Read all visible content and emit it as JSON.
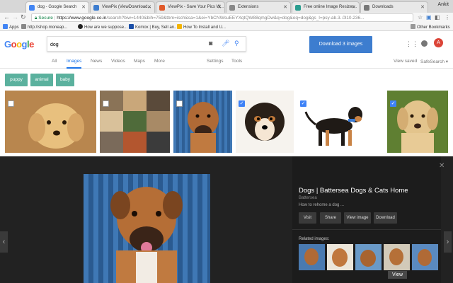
{
  "browser": {
    "tabs": [
      {
        "title": "dog - Google Search",
        "favicon_color": "#4285f4"
      },
      {
        "title": "ViewPix (ViewDownload...",
        "favicon_color": "#3d7dcf"
      },
      {
        "title": "ViewPix - Save Your Pics W...",
        "favicon_color": "#e05a2b"
      },
      {
        "title": "Extensions",
        "favicon_color": "#888888"
      },
      {
        "title": "Free online Image Resizer...",
        "favicon_color": "#2a9d8f"
      },
      {
        "title": "Downloads",
        "favicon_color": "#777777"
      }
    ],
    "profile_name": "Ankit",
    "secure_label": "Secure",
    "url_host": "https://www.google.co.in",
    "url_rest": "/search?biw=1440&bih=759&tbm=isch&sa=1&ei=YbCNWsuEEYXqtQW88qmgDw&q=dog&oq=dog&gs_l=psy-ab.3..0l10.236...",
    "bookmarks": [
      {
        "label": "Apps",
        "icon_color": "#4285f4"
      },
      {
        "label": "http://shop.moneap...",
        "icon_color": "#888888"
      },
      {
        "label": "How are we suppose...",
        "icon_color": "#222222"
      },
      {
        "label": "Komox | Buy, Sell an...",
        "icon_color": "#1b4fa8"
      },
      {
        "label": "How To Install and U...",
        "icon_color": "#f4b400"
      }
    ],
    "other_bookmarks": "Other Bookmarks"
  },
  "google": {
    "logo_letters": [
      "G",
      "o",
      "o",
      "g",
      "l",
      "e"
    ],
    "search_value": "dog",
    "download_button": "Download 3 images",
    "avatar_letter": "A",
    "nav": [
      "All",
      "Images",
      "News",
      "Videos",
      "Maps",
      "More"
    ],
    "settings": "Settings",
    "tools": "Tools",
    "view_saved": "View saved",
    "safesearch": "SafeSearch ▾",
    "chips": [
      "puppy",
      "animal",
      "baby"
    ],
    "checkmark": "✓"
  },
  "preview": {
    "title": "Dogs | Battersea Dogs & Cats Home",
    "source": "Battersea",
    "description": "How to rehome a dog ...",
    "buttons": [
      "Visit",
      "Share",
      "View image",
      "Download"
    ],
    "related_label": "Related images:",
    "view_more": "View"
  },
  "colors": {
    "accent": "#1a73e8",
    "download_button": "#3d7dcf",
    "chip": "#5bb19e",
    "checkbox_checked": "#3e82f7"
  }
}
